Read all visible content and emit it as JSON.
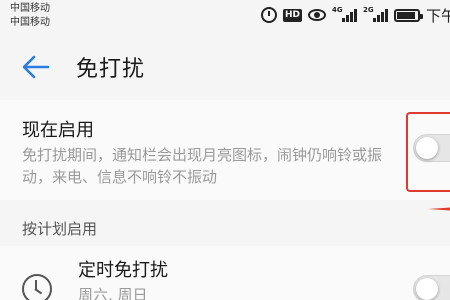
{
  "status_bar": {
    "carrier_1": "中国移动",
    "carrier_2": "中国移动",
    "hd_label": "HD",
    "signal_1_net": "4G",
    "signal_2_net": "2G",
    "clock_partial": "下午",
    "icons": [
      "alarm-icon",
      "hd-icon",
      "eye-icon",
      "signal-icon",
      "signal-icon",
      "battery-icon"
    ]
  },
  "header": {
    "back_icon": "arrow-left",
    "title": "免打扰",
    "accent_color": "#2a7de1"
  },
  "main_setting": {
    "title": "现在启用",
    "description": "免打扰期间，通知栏会出现月亮图标，闹钟仍响铃或振动，来电、信息不响铃不振动",
    "toggle_state": "off"
  },
  "schedule_section": {
    "header": "按计划启用",
    "item": {
      "icon": "clock-icon",
      "title": "定时免打扰",
      "subtitle": "周六, 周日",
      "toggle_state": "off"
    }
  },
  "annotation": {
    "color": "#e03a2e"
  }
}
